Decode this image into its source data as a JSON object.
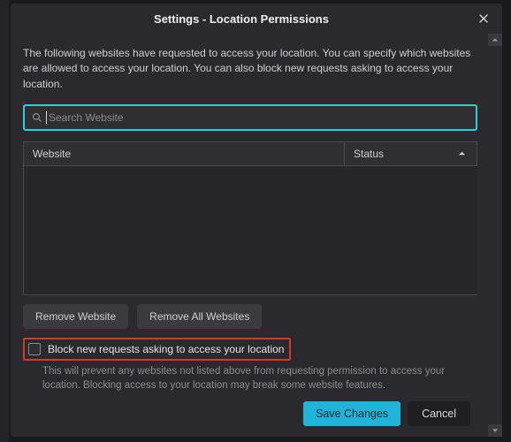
{
  "dialog": {
    "title": "Settings - Location Permissions",
    "intro": "The following websites have requested to access your location. You can specify which websites are allowed to access your location. You can also block new requests asking to access your location."
  },
  "search": {
    "placeholder": "Search Website",
    "value": ""
  },
  "table": {
    "columns": {
      "website": "Website",
      "status": "Status"
    }
  },
  "buttons": {
    "remove": "Remove Website",
    "remove_all": "Remove All Websites",
    "save": "Save Changes",
    "cancel": "Cancel"
  },
  "block": {
    "label": "Block new requests asking to access your location",
    "helper": "This will prevent any websites not listed above from requesting permission to access your location. Blocking access to your location may break some website features."
  }
}
